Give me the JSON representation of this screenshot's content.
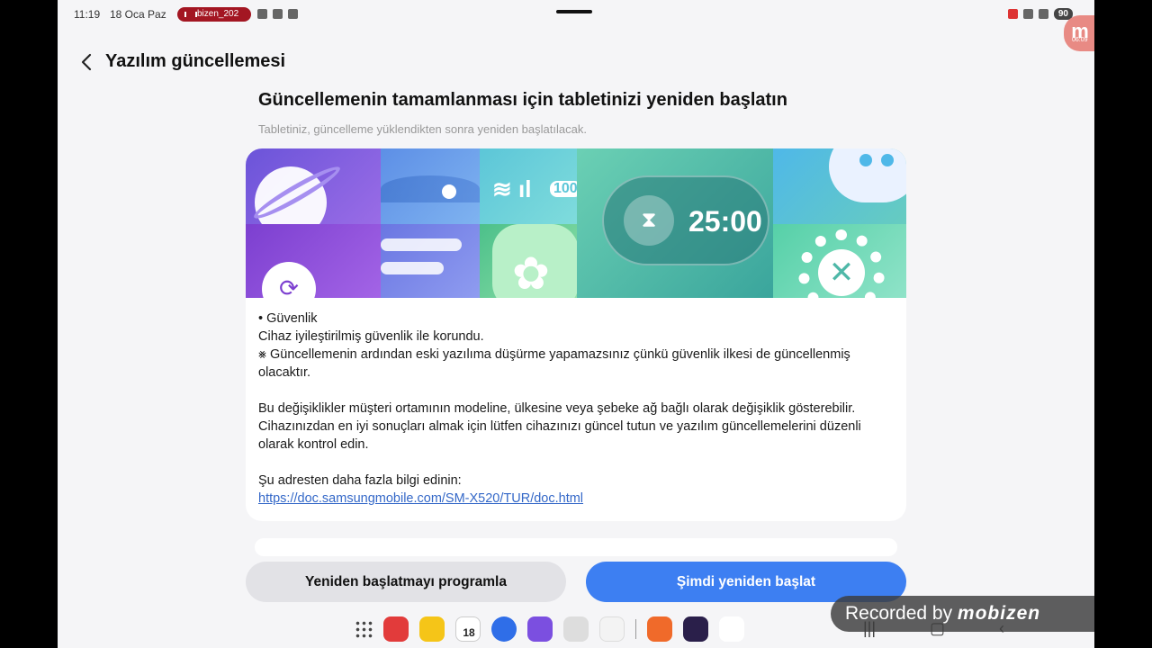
{
  "status_bar": {
    "time": "11:19",
    "date": "18 Oca Paz",
    "recording_pill": "bizen_202",
    "battery": "90"
  },
  "mobizen_badge": {
    "letter": "m",
    "time": "06:09"
  },
  "header": {
    "title": "Yazılım güncellemesi"
  },
  "main": {
    "heading": "Güncellemenin tamamlanması için tabletinizi yeniden başlatın",
    "subheading": "Tabletiniz, güncelleme yüklendikten sonra yeniden başlatılacak.",
    "banner": {
      "timer": "25:00",
      "percent": "100"
    },
    "notes": {
      "security_title": "• Güvenlik",
      "security_line": "Cihaz iyileştirilmiş güvenlik ile korundu.",
      "downgrade_note": "⨳ Güncellemenin ardından eski yazılıma düşürme yapamazsınız çünkü güvenlik ilkesi de güncellenmiş olacaktır.",
      "variation_note": "Bu değişiklikler müşteri ortamının modeline, ülkesine veya şebeke ağ bağlı olarak değişiklik gösterebilir. Cihazınızdan en iyi sonuçları almak için lütfen cihazınızı güncel tutun ve yazılım güncellemelerini düzenli olarak kontrol edin.",
      "more_info": "Şu adresten daha fazla bilgi edinin:",
      "link": "https://doc.samsungmobile.com/SM-X520/TUR/doc.html"
    }
  },
  "buttons": {
    "schedule": "Yeniden başlatmayı programla",
    "restart_now": "Şimdi yeniden başlat"
  },
  "dock": {
    "calendar_day": "18",
    "apps": [
      "apps-grid-icon",
      "notes-app-icon",
      "memo-app-icon",
      "calendar-app-icon",
      "messages-app-icon",
      "internet-app-icon",
      "camera-app-icon",
      "shortcuts-app-icon",
      "recorder-app-icon",
      "vpn-app-icon",
      "youtube-app-icon"
    ]
  },
  "watermark": {
    "text": "Recorded by",
    "brand": "mobizen"
  },
  "colors": {
    "accent": "#3d7ff2",
    "link": "#3468c8",
    "background": "#f5f5f7"
  }
}
